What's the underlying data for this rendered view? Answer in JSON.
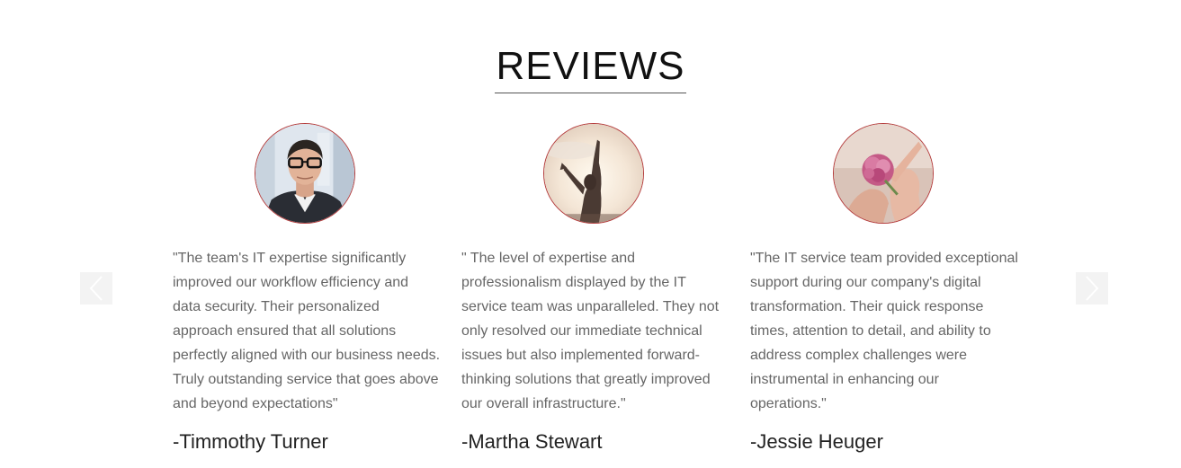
{
  "section": {
    "title": "REVIEWS"
  },
  "colors": {
    "avatar_border": "#b33a3a",
    "quote_text": "#666666",
    "nav_bg": "#f3f3f3"
  },
  "navigation": {
    "prev_icon": "chevron-left-icon",
    "next_icon": "chevron-right-icon"
  },
  "reviews": [
    {
      "avatar": "portrait-of-man-with-glasses",
      "quote_lines": [
        "\"The team's IT expertise significantly",
        "improved our workflow efficiency and",
        "data security. Their personalized",
        "approach ensured that all solutions",
        "perfectly aligned with our business needs.",
        "Truly outstanding service that goes above",
        "and beyond expectations\""
      ],
      "author": "-Timmothy Turner"
    },
    {
      "avatar": "woman-raising-arm-at-sunset",
      "quote_lines": [
        "\" The level of expertise and",
        "professionalism displayed by the IT",
        "service team was unparalleled. They not",
        "only resolved our immediate technical",
        "issues but also implemented forward-",
        "thinking solutions that greatly improved",
        "our overall infrastructure.\""
      ],
      "author": "-Martha Stewart"
    },
    {
      "avatar": "hand-holding-pink-flower",
      "quote_lines": [
        "\"The IT service team provided exceptional",
        "support during our company's digital",
        "transformation. Their quick response",
        "times, attention to detail, and ability to",
        "address complex challenges were",
        "instrumental in enhancing our",
        "operations.\""
      ],
      "author": "-Jessie Heuger"
    }
  ]
}
